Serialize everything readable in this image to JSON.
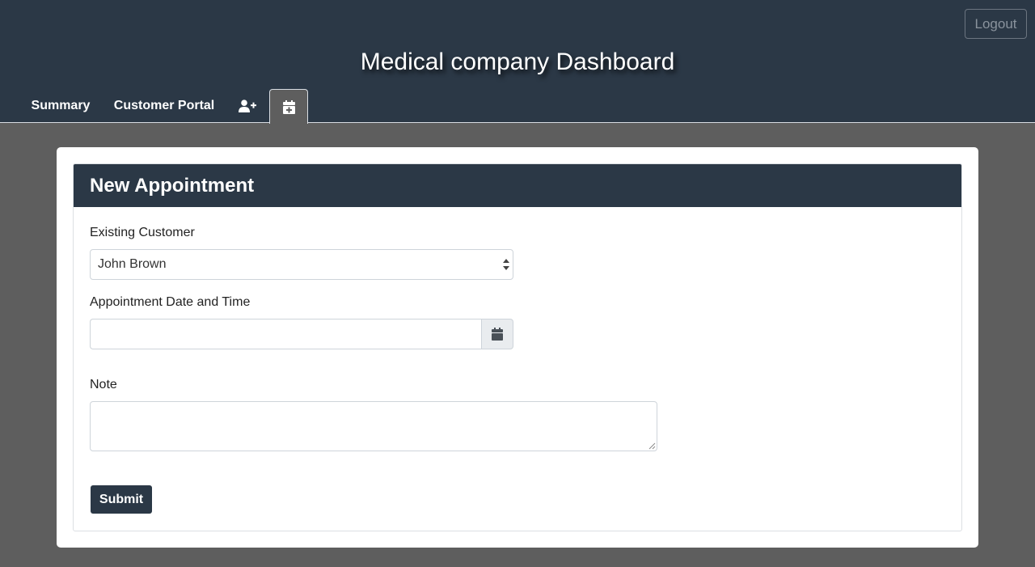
{
  "header": {
    "title": "Medical company Dashboard",
    "logout_label": "Logout",
    "bg_color": "#2b3846"
  },
  "nav": {
    "tabs": [
      {
        "label": "Summary",
        "active": false
      },
      {
        "label": "Customer Portal",
        "active": false
      },
      {
        "icon": "add-user-icon",
        "active": false
      },
      {
        "icon": "calendar-plus-icon",
        "active": true
      }
    ]
  },
  "form": {
    "title": "New Appointment",
    "customer_label": "Existing Customer",
    "customer_value": "John Brown",
    "datetime_label": "Appointment Date and Time",
    "datetime_value": "",
    "note_label": "Note",
    "note_value": "",
    "submit_label": "Submit",
    "calendar_icon": "calendar-icon"
  }
}
